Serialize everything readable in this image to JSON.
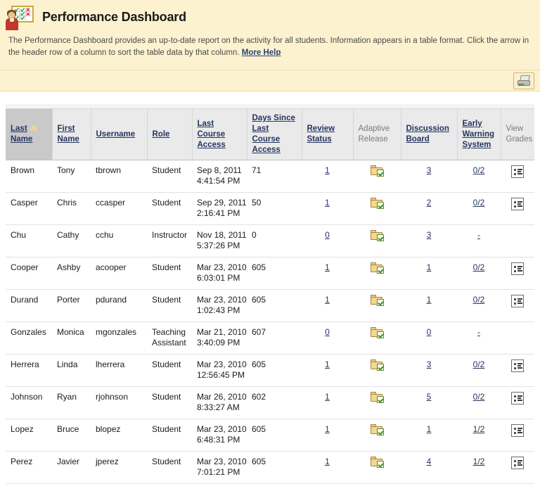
{
  "header": {
    "title": "Performance Dashboard",
    "icon": "dashboard-person-chart-icon",
    "description_part1": "The Performance Dashboard provides an up-to-date report on the activity for all students. Information appears in a table format. Click the arrow in the header row of a column to sort the table data by that column.",
    "more_help_label": "More Help"
  },
  "action_bar": {
    "print_icon": "printer-icon",
    "print_title": "Print"
  },
  "table": {
    "sorted_column": "Last Name",
    "sort_direction": "ascending",
    "sort_arrow_icon": "sort-ascending-triangle-icon",
    "columns": [
      {
        "label": "Last Name",
        "link": true,
        "sorted": true
      },
      {
        "label": "First Name",
        "link": true,
        "sorted": false
      },
      {
        "label": "Username",
        "link": true,
        "sorted": false
      },
      {
        "label": "Role",
        "link": true,
        "sorted": false
      },
      {
        "label": "Last Course Access",
        "link": true,
        "sorted": false
      },
      {
        "label": "Days Since Last Course Access",
        "link": true,
        "sorted": false
      },
      {
        "label": "Review Status",
        "link": true,
        "sorted": false
      },
      {
        "label": "Adaptive Release",
        "link": false,
        "sorted": false
      },
      {
        "label": "Discussion Board",
        "link": true,
        "sorted": false
      },
      {
        "label": "Early Warning System",
        "link": true,
        "sorted": false
      },
      {
        "label": "View Grades",
        "link": false,
        "sorted": false
      }
    ],
    "rows": [
      {
        "last_name": "Brown",
        "first_name": "Tony",
        "username": "tbrown",
        "role": "Student",
        "last_access_date": "Sep 8, 2011",
        "last_access_time": "4:41:54 PM",
        "days_since": "71",
        "review_status": "1",
        "adaptive_release": "folder-check-icon",
        "discussion_board": "3",
        "early_warning": "0/2",
        "view_grades": "grades-list-icon"
      },
      {
        "last_name": "Casper",
        "first_name": "Chris",
        "username": "ccasper",
        "role": "Student",
        "last_access_date": "Sep 29, 2011",
        "last_access_time": "2:16:41 PM",
        "days_since": "50",
        "review_status": "1",
        "adaptive_release": "folder-check-icon",
        "discussion_board": "2",
        "early_warning": "0/2",
        "view_grades": "grades-list-icon"
      },
      {
        "last_name": "Chu",
        "first_name": "Cathy",
        "username": "cchu",
        "role": "Instructor",
        "last_access_date": "Nov 18, 2011",
        "last_access_time": "5:37:26 PM",
        "days_since": "0",
        "review_status": "0",
        "adaptive_release": "folder-check-icon",
        "discussion_board": "3",
        "early_warning": "-",
        "view_grades": ""
      },
      {
        "last_name": "Cooper",
        "first_name": "Ashby",
        "username": "acooper",
        "role": "Student",
        "last_access_date": "Mar 23, 2010",
        "last_access_time": "6:03:01 PM",
        "days_since": "605",
        "review_status": "1",
        "adaptive_release": "folder-check-icon",
        "discussion_board": "1",
        "early_warning": "0/2",
        "view_grades": "grades-list-icon"
      },
      {
        "last_name": "Durand",
        "first_name": "Porter",
        "username": "pdurand",
        "role": "Student",
        "last_access_date": "Mar 23, 2010",
        "last_access_time": "1:02:43 PM",
        "days_since": "605",
        "review_status": "1",
        "adaptive_release": "folder-check-icon",
        "discussion_board": "1",
        "early_warning": "0/2",
        "view_grades": "grades-list-icon"
      },
      {
        "last_name": "Gonzales",
        "first_name": "Monica",
        "username": "mgonzales",
        "role": "Teaching Assistant",
        "last_access_date": "Mar 21, 2010",
        "last_access_time": "3:40:09 PM",
        "days_since": "607",
        "review_status": "0",
        "adaptive_release": "folder-check-icon",
        "discussion_board": "0",
        "early_warning": "-",
        "view_grades": ""
      },
      {
        "last_name": "Herrera",
        "first_name": "Linda",
        "username": "lherrera",
        "role": "Student",
        "last_access_date": "Mar 23, 2010",
        "last_access_time": "12:56:45 PM",
        "days_since": "605",
        "review_status": "1",
        "adaptive_release": "folder-check-icon",
        "discussion_board": "3",
        "early_warning": "0/2",
        "view_grades": "grades-list-icon"
      },
      {
        "last_name": "Johnson",
        "first_name": "Ryan",
        "username": "rjohnson",
        "role": "Student",
        "last_access_date": "Mar 26, 2010",
        "last_access_time": "8:33:27 AM",
        "days_since": "602",
        "review_status": "1",
        "adaptive_release": "folder-check-icon",
        "discussion_board": "5",
        "early_warning": "0/2",
        "view_grades": "grades-list-icon"
      },
      {
        "last_name": "Lopez",
        "first_name": "Bruce",
        "username": "blopez",
        "role": "Student",
        "last_access_date": "Mar 23, 2010",
        "last_access_time": "6:48:31 PM",
        "days_since": "605",
        "review_status": "1",
        "adaptive_release": "folder-check-icon",
        "discussion_board": "1",
        "early_warning": "1/2",
        "view_grades": "grades-list-icon"
      },
      {
        "last_name": "Perez",
        "first_name": "Javier",
        "username": "jperez",
        "role": "Student",
        "last_access_date": "Mar 23, 2010",
        "last_access_time": "7:01:21 PM",
        "days_since": "605",
        "review_status": "1",
        "adaptive_release": "folder-check-icon",
        "discussion_board": "4",
        "early_warning": "1/2",
        "view_grades": "grades-list-icon"
      }
    ]
  },
  "colors": {
    "banner_bg": "#fdf2cf",
    "link": "#25355e",
    "header_bg": "#eaeaea",
    "sorted_header_bg": "#c9c9c9"
  }
}
